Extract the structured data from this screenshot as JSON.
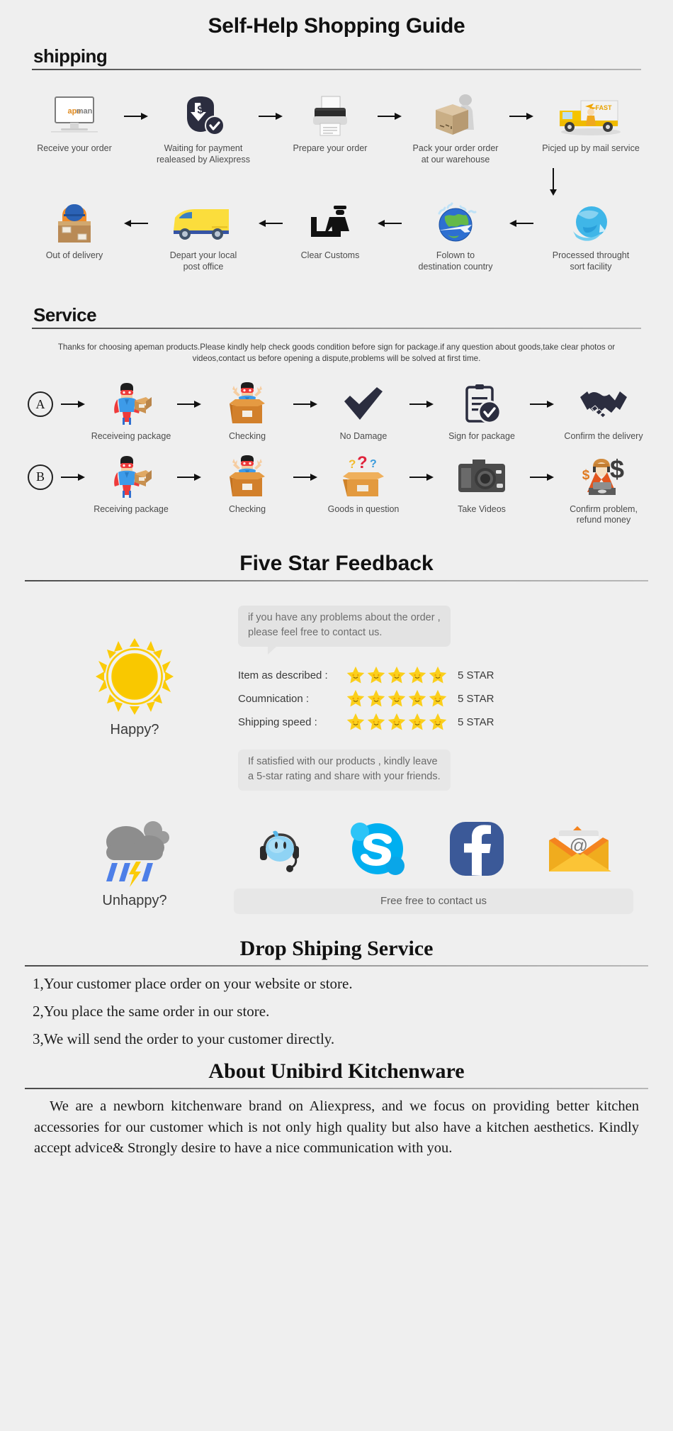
{
  "page": {
    "title": "Self-Help Shopping Guide",
    "background_color": "#efefef"
  },
  "shipping": {
    "heading": "shipping",
    "row1": [
      {
        "caption": "Receive your order",
        "icon": "monitor-apeman-icon",
        "brand": "apeman"
      },
      {
        "caption": "Waiting for payment\nrealeased by Aliexpress",
        "icon": "payment-dollar-check-icon"
      },
      {
        "caption": "Prepare your order",
        "icon": "printer-icon"
      },
      {
        "caption": "Pack your order order\nat our warehouse",
        "icon": "packing-box-worker-icon"
      },
      {
        "caption": "Picjed up by mail service",
        "icon": "fast-delivery-truck-icon"
      }
    ],
    "row2": [
      {
        "caption": "Out of delivery",
        "icon": "courier-carrying-box-icon"
      },
      {
        "caption": "Depart your local\npost office",
        "icon": "yellow-van-icon"
      },
      {
        "caption": "Clear Customs",
        "icon": "customs-officer-icon"
      },
      {
        "caption": "Folown to\ndestination country",
        "icon": "globe-airplane-icon"
      },
      {
        "caption": "Processed throught\nsort facility",
        "icon": "blue-globe-icon"
      }
    ]
  },
  "service": {
    "heading": "Service",
    "note": "Thanks for choosing apeman products.Please kindly help check goods condition before sign for package.if any question about goods,take clear photos or videos,contact us before opening a dispute,problems will be solved at first time.",
    "row_a": {
      "badge": "A",
      "steps": [
        {
          "caption": "Receiveing package",
          "icon": "hero-holding-package-icon"
        },
        {
          "caption": "Checking",
          "icon": "hero-in-box-icon"
        },
        {
          "caption": "No Damage",
          "icon": "checkmark-icon"
        },
        {
          "caption": "Sign for package",
          "icon": "clipboard-check-icon"
        },
        {
          "caption": "Confirm the delivery",
          "icon": "handshake-icon"
        }
      ]
    },
    "row_b": {
      "badge": "B",
      "steps": [
        {
          "caption": "Receiving package",
          "icon": "hero-holding-package-icon"
        },
        {
          "caption": "Checking",
          "icon": "hero-in-box-icon"
        },
        {
          "caption": "Goods in question",
          "icon": "box-question-marks-icon"
        },
        {
          "caption": "Take Videos",
          "icon": "camera-icon"
        },
        {
          "caption": "Confirm problem,\nrefund money",
          "icon": "support-agent-dollar-icon"
        }
      ]
    }
  },
  "feedback": {
    "heading": "Five Star Feedback",
    "bubble_text": "if you have any problems about the order ,\nplease feel free to contact us.",
    "happy_label": "Happy?",
    "happy_icon": "sun-icon",
    "ratings": [
      {
        "label": "Item as described :",
        "stars": 5,
        "value": "5 STAR"
      },
      {
        "label": "Coumnication :",
        "stars": 5,
        "value": "5 STAR"
      },
      {
        "label": "Shipping speed :",
        "stars": 5,
        "value": "5 STAR"
      }
    ],
    "satisfied_text": "If satisfied with our products ,  kindly leave\na 5-star rating and share with your friends.",
    "unhappy_label": "Unhappy?",
    "unhappy_icon": "storm-cloud-icon",
    "social": [
      {
        "name": "aliwangwang-icon",
        "label": "Aliwangwang"
      },
      {
        "name": "skype-icon",
        "label": "Skype"
      },
      {
        "name": "facebook-icon",
        "label": "Facebook"
      },
      {
        "name": "email-icon",
        "label": "Email"
      }
    ],
    "contact_bar": "Free free to contact us",
    "star_color": "#ffd21e",
    "skype_color": "#00aff0",
    "facebook_color": "#3b5998"
  },
  "dropshipping": {
    "heading": "Drop Shiping Service",
    "items": [
      "1,Your customer place order on your website or store.",
      "2,You place the same order in our store.",
      "3,We will send the order to your customer directly."
    ]
  },
  "about": {
    "heading": "About Unibird Kitchenware",
    "body": "We are a newborn kitchenware brand on Aliexpress, and we focus on providing better kitchen accessories for our customer which is not only high quality but also have a kitchen aesthetics. Kindly accept advice& Strongly desire to have a nice communication with you."
  }
}
